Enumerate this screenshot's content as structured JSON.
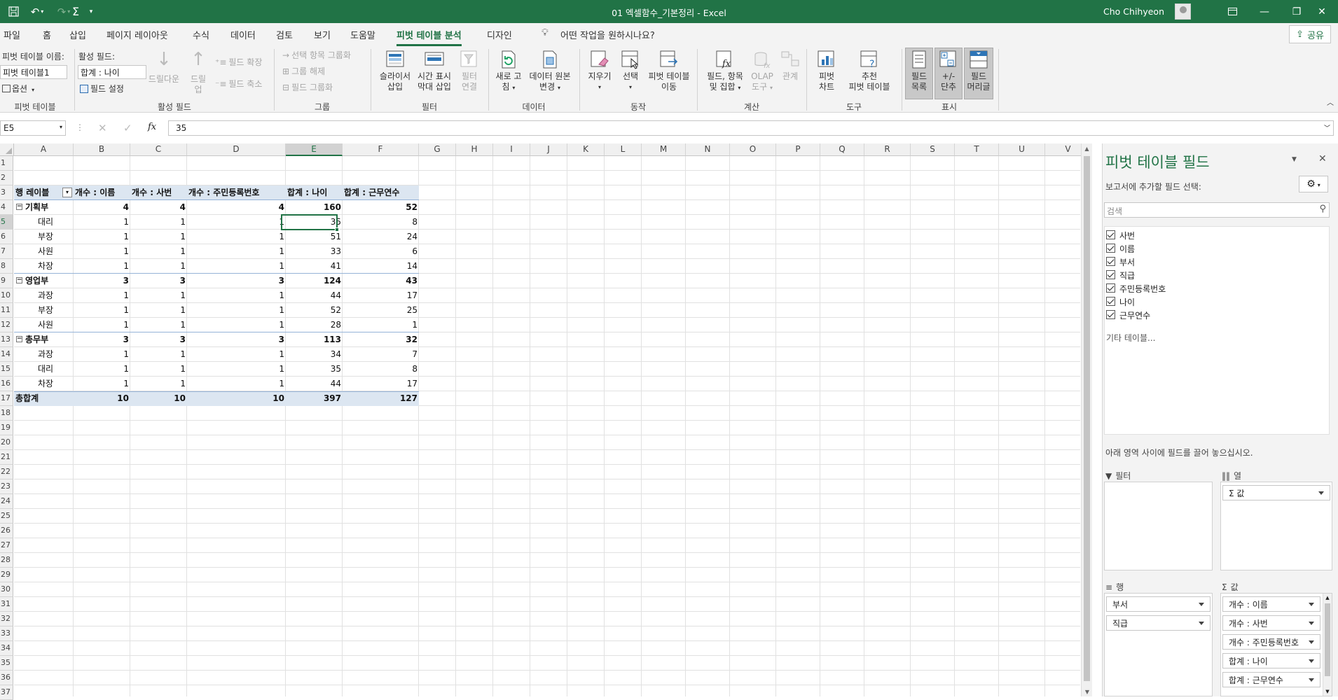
{
  "titlebar": {
    "title": "01 엑셀함수_기본정리  -  Excel",
    "user": "Cho Chihyeon"
  },
  "tabs": [
    "파일",
    "홈",
    "삽입",
    "페이지 레이아웃",
    "수식",
    "데이터",
    "검토",
    "보기",
    "도움말",
    "피벗 테이블 분석",
    "디자인"
  ],
  "tell_me": "어떤 작업을 원하시나요?",
  "share": "공유",
  "ribbon": {
    "pivot_name_label": "피벗 테이블 이름:",
    "pivot_name_value": "피벗 테이블1",
    "options_label": "옵션",
    "group_pivot": "피벗 테이블",
    "active_field_label": "활성 필드:",
    "active_field_value": "합계 : 나이",
    "field_settings": "필드 설정",
    "drill_down": "드릴다운",
    "drill_up_1": "드릴",
    "drill_up_2": "업",
    "expand_field": "필드 확장",
    "collapse_field": "필드 축소",
    "group_active_field": "활성 필드",
    "group_selection": "선택 항목 그룹화",
    "ungroup": "그룹 해제",
    "group_field": "필드 그룹화",
    "group_group": "그룹",
    "slicer_1": "슬라이서",
    "slicer_2": "삽입",
    "timeline_1": "시간 표시",
    "timeline_2": "막대 삽입",
    "filter_conn_1": "필터",
    "filter_conn_2": "연결",
    "group_filter": "필터",
    "refresh_1": "새로 고",
    "refresh_2": "침",
    "change_source_1": "데이터 원본",
    "change_source_2": "변경",
    "group_data": "데이터",
    "clear": "지우기",
    "select": "선택",
    "move_1": "피벗 테이블",
    "move_2": "이동",
    "group_actions": "동작",
    "fields_items_1": "필드, 항목",
    "fields_items_2": "및 집합",
    "olap_1": "OLAP",
    "olap_2": "도구",
    "relations": "관계",
    "group_calc": "계산",
    "pivot_chart_1": "피벗",
    "pivot_chart_2": "차트",
    "recommended_1": "추천",
    "recommended_2": "피벗 테이블",
    "group_tools": "도구",
    "field_list_1": "필드",
    "field_list_2": "목록",
    "buttons_1": "+/-",
    "buttons_2": "단추",
    "headers_1": "필드",
    "headers_2": "머리글",
    "group_show": "표시"
  },
  "formula_bar": {
    "name_box": "E5",
    "formula": "35"
  },
  "columns": [
    "A",
    "B",
    "C",
    "D",
    "E",
    "F",
    "G",
    "H",
    "I",
    "J",
    "K",
    "L",
    "M",
    "N",
    "O",
    "P",
    "Q",
    "R",
    "S",
    "T",
    "U",
    "V"
  ],
  "rows": [
    "1",
    "2",
    "3",
    "4",
    "5",
    "6",
    "7",
    "8",
    "9",
    "10",
    "11",
    "12",
    "13",
    "14",
    "15",
    "16",
    "17",
    "18",
    "19",
    "20",
    "21",
    "22",
    "23",
    "24",
    "25",
    "26",
    "27",
    "28",
    "29",
    "30",
    "31",
    "32",
    "33",
    "34",
    "35",
    "36",
    "37"
  ],
  "pivot": {
    "headers": [
      "행 레이블",
      "개수 : 이름",
      "개수 : 사번",
      "개수 : 주민등록번호",
      "합계 : 나이",
      "합계 : 근무연수"
    ],
    "body": [
      {
        "label": "기획부",
        "vals": [
          "4",
          "4",
          "4",
          "160",
          "52"
        ],
        "type": "group"
      },
      {
        "label": "대리",
        "vals": [
          "1",
          "1",
          "1",
          "35",
          "8"
        ],
        "type": "item"
      },
      {
        "label": "부장",
        "vals": [
          "1",
          "1",
          "1",
          "51",
          "24"
        ],
        "type": "item"
      },
      {
        "label": "사원",
        "vals": [
          "1",
          "1",
          "1",
          "33",
          "6"
        ],
        "type": "item"
      },
      {
        "label": "차장",
        "vals": [
          "1",
          "1",
          "1",
          "41",
          "14"
        ],
        "type": "item"
      },
      {
        "label": "영업부",
        "vals": [
          "3",
          "3",
          "3",
          "124",
          "43"
        ],
        "type": "group"
      },
      {
        "label": "과장",
        "vals": [
          "1",
          "1",
          "1",
          "44",
          "17"
        ],
        "type": "item"
      },
      {
        "label": "부장",
        "vals": [
          "1",
          "1",
          "1",
          "52",
          "25"
        ],
        "type": "item"
      },
      {
        "label": "사원",
        "vals": [
          "1",
          "1",
          "1",
          "28",
          "1"
        ],
        "type": "item"
      },
      {
        "label": "총무부",
        "vals": [
          "3",
          "3",
          "3",
          "113",
          "32"
        ],
        "type": "group"
      },
      {
        "label": "과장",
        "vals": [
          "1",
          "1",
          "1",
          "34",
          "7"
        ],
        "type": "item"
      },
      {
        "label": "대리",
        "vals": [
          "1",
          "1",
          "1",
          "35",
          "8"
        ],
        "type": "item"
      },
      {
        "label": "차장",
        "vals": [
          "1",
          "1",
          "1",
          "44",
          "17"
        ],
        "type": "item"
      },
      {
        "label": "총합계",
        "vals": [
          "10",
          "10",
          "10",
          "397",
          "127"
        ],
        "type": "total"
      }
    ]
  },
  "pane": {
    "title": "피벗 테이블 필드",
    "choose_label": "보고서에 추가할 필드 선택:",
    "search_placeholder": "검색",
    "fields": [
      "사번",
      "이름",
      "부서",
      "직급",
      "주민등록번호",
      "나이",
      "근무연수"
    ],
    "more_tables": "기타 테이블...",
    "drag_hint": "아래 영역 사이에 필드를 끌어 놓으십시오.",
    "filters_label": "필터",
    "columns_label": "열",
    "rows_label": "행",
    "values_label": "값",
    "columns_items": [
      "Σ 값"
    ],
    "rows_items": [
      "부서",
      "직급"
    ],
    "values_items": [
      "개수 : 이름",
      "개수 : 사번",
      "개수 : 주민등록번호",
      "합계 : 나이",
      "합계 : 근무연수"
    ]
  },
  "colors": {
    "accent": "#217346",
    "pivot_header": "#dce6f1",
    "pivot_line": "#95b3d7"
  }
}
